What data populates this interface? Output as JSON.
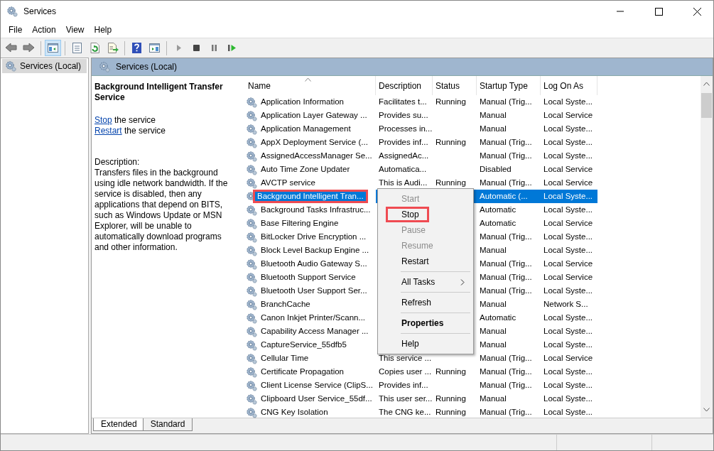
{
  "window": {
    "title": "Services"
  },
  "menu_bar": [
    "File",
    "Action",
    "View",
    "Help"
  ],
  "toolbar": [
    {
      "kind": "back",
      "pressed": false
    },
    {
      "kind": "forward",
      "pressed": false
    },
    {
      "kind": "sep"
    },
    {
      "kind": "tree",
      "pressed": true
    },
    {
      "kind": "sep"
    },
    {
      "kind": "properties",
      "pressed": false
    },
    {
      "kind": "refresh",
      "pressed": false
    },
    {
      "kind": "export",
      "pressed": false
    },
    {
      "kind": "sep"
    },
    {
      "kind": "help",
      "pressed": false
    },
    {
      "kind": "action-pane",
      "pressed": false
    },
    {
      "kind": "sep"
    },
    {
      "kind": "play",
      "pressed": false
    },
    {
      "kind": "stop",
      "pressed": false
    },
    {
      "kind": "pause",
      "pressed": false
    },
    {
      "kind": "resume",
      "pressed": false
    }
  ],
  "tree": [
    {
      "label": "Services (Local)",
      "selected": true
    }
  ],
  "panel_header": "Services (Local)",
  "details": {
    "title": "Background Intelligent Transfer Service",
    "actions": [
      {
        "link": "Stop",
        "text": "the service"
      },
      {
        "link": "Restart",
        "text": "the service"
      }
    ],
    "description_label": "Description:",
    "description": "Transfers files in the background using idle network bandwidth. If the service is disabled, then any applications that depend on BITS, such as Windows Update or MSN Explorer, will be unable to automatically download programs and other information."
  },
  "table": {
    "columns": [
      {
        "label": "Name",
        "sorted": true
      },
      {
        "label": "Description",
        "sorted": false
      },
      {
        "label": "Status",
        "sorted": false
      },
      {
        "label": "Startup Type",
        "sorted": false
      },
      {
        "label": "Log On As",
        "sorted": false
      }
    ],
    "rows": [
      {
        "cells": [
          "Application Information",
          "Facilitates t...",
          "Running",
          "Manual (Trig...",
          "Local Syste..."
        ],
        "selected": false,
        "highlighted": false
      },
      {
        "cells": [
          "Application Layer Gateway ...",
          "Provides su...",
          "",
          "Manual",
          "Local Service"
        ],
        "selected": false,
        "highlighted": false
      },
      {
        "cells": [
          "Application Management",
          "Processes in...",
          "",
          "Manual",
          "Local Syste..."
        ],
        "selected": false,
        "highlighted": false
      },
      {
        "cells": [
          "AppX Deployment Service (...",
          "Provides inf...",
          "Running",
          "Manual (Trig...",
          "Local Syste..."
        ],
        "selected": false,
        "highlighted": false
      },
      {
        "cells": [
          "AssignedAccessManager Se...",
          "AssignedAc...",
          "",
          "Manual (Trig...",
          "Local Syste..."
        ],
        "selected": false,
        "highlighted": false
      },
      {
        "cells": [
          "Auto Time Zone Updater",
          "Automatica...",
          "",
          "Disabled",
          "Local Service"
        ],
        "selected": false,
        "highlighted": false
      },
      {
        "cells": [
          "AVCTP service",
          "This is Audi...",
          "Running",
          "Manual (Trig...",
          "Local Service"
        ],
        "selected": false,
        "highlighted": false
      },
      {
        "cells": [
          "Background Intelligent Tran...",
          "",
          "",
          "Automatic (...",
          "Local Syste..."
        ],
        "selected": true,
        "highlighted": true
      },
      {
        "cells": [
          "Background Tasks Infrastruc...",
          "",
          "",
          "Automatic",
          "Local Syste..."
        ],
        "selected": false,
        "highlighted": false
      },
      {
        "cells": [
          "Base Filtering Engine",
          "",
          "",
          "Automatic",
          "Local Service"
        ],
        "selected": false,
        "highlighted": false
      },
      {
        "cells": [
          "BitLocker Drive Encryption ...",
          "",
          "",
          "Manual (Trig...",
          "Local Syste..."
        ],
        "selected": false,
        "highlighted": false
      },
      {
        "cells": [
          "Block Level Backup Engine ...",
          "",
          "",
          "Manual",
          "Local Syste..."
        ],
        "selected": false,
        "highlighted": false
      },
      {
        "cells": [
          "Bluetooth Audio Gateway S...",
          "",
          "",
          "Manual (Trig...",
          "Local Service"
        ],
        "selected": false,
        "highlighted": false
      },
      {
        "cells": [
          "Bluetooth Support Service",
          "",
          "",
          "Manual (Trig...",
          "Local Service"
        ],
        "selected": false,
        "highlighted": false
      },
      {
        "cells": [
          "Bluetooth User Support Ser...",
          "",
          "",
          "Manual (Trig...",
          "Local Syste..."
        ],
        "selected": false,
        "highlighted": false
      },
      {
        "cells": [
          "BranchCache",
          "",
          "",
          "Manual",
          "Network S..."
        ],
        "selected": false,
        "highlighted": false
      },
      {
        "cells": [
          "Canon Inkjet Printer/Scann...",
          "",
          "",
          "Automatic",
          "Local Syste..."
        ],
        "selected": false,
        "highlighted": false
      },
      {
        "cells": [
          "Capability Access Manager ...",
          "",
          "",
          "Manual",
          "Local Syste..."
        ],
        "selected": false,
        "highlighted": false
      },
      {
        "cells": [
          "CaptureService_55dfb5",
          "",
          "",
          "Manual",
          "Local Syste..."
        ],
        "selected": false,
        "highlighted": false
      },
      {
        "cells": [
          "Cellular Time",
          "This service ...",
          "",
          "Manual (Trig...",
          "Local Service"
        ],
        "selected": false,
        "highlighted": false
      },
      {
        "cells": [
          "Certificate Propagation",
          "Copies user ...",
          "Running",
          "Manual (Trig...",
          "Local Syste..."
        ],
        "selected": false,
        "highlighted": false
      },
      {
        "cells": [
          "Client License Service (ClipS...",
          "Provides inf...",
          "",
          "Manual (Trig...",
          "Local Syste..."
        ],
        "selected": false,
        "highlighted": false
      },
      {
        "cells": [
          "Clipboard User Service_55df...",
          "This user ser...",
          "Running",
          "Manual",
          "Local Syste..."
        ],
        "selected": false,
        "highlighted": false
      },
      {
        "cells": [
          "CNG Key Isolation",
          "The CNG ke...",
          "Running",
          "Manual (Trig...",
          "Local Syste..."
        ],
        "selected": false,
        "highlighted": false
      }
    ]
  },
  "context_menu": [
    {
      "kind": "item",
      "label": "Start",
      "disabled": true,
      "highlighted": false
    },
    {
      "kind": "item",
      "label": "Stop",
      "disabled": false,
      "highlighted": true
    },
    {
      "kind": "item",
      "label": "Pause",
      "disabled": true,
      "highlighted": false
    },
    {
      "kind": "item",
      "label": "Resume",
      "disabled": true,
      "highlighted": false
    },
    {
      "kind": "item",
      "label": "Restart",
      "disabled": false,
      "highlighted": false
    },
    {
      "kind": "separator"
    },
    {
      "kind": "submenu",
      "label": "All Tasks",
      "disabled": false,
      "highlighted": false
    },
    {
      "kind": "separator"
    },
    {
      "kind": "item",
      "label": "Refresh",
      "disabled": false,
      "highlighted": false
    },
    {
      "kind": "separator"
    },
    {
      "kind": "default",
      "label": "Properties",
      "disabled": false,
      "highlighted": false
    },
    {
      "kind": "separator"
    },
    {
      "kind": "item",
      "label": "Help",
      "disabled": false,
      "highlighted": false
    }
  ],
  "view_tabs": [
    {
      "label": "Extended",
      "selected": true
    },
    {
      "label": "Standard",
      "selected": false
    }
  ]
}
